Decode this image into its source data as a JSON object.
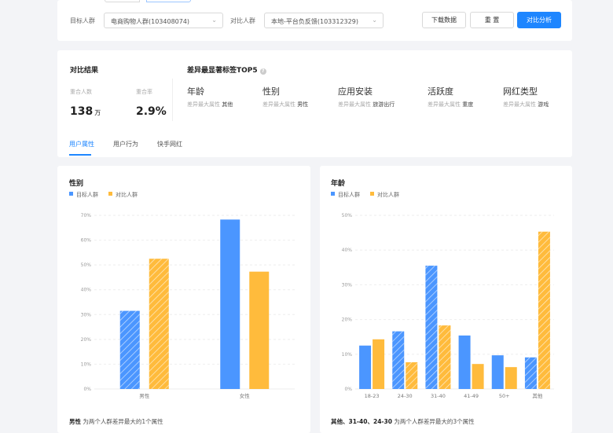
{
  "filters": {
    "target_label": "目标人群",
    "target_value": "电商购物人群(103408074)",
    "compare_label": "对比人群",
    "compare_value": "本地-平台负反馈(103312329)",
    "download": "下载数据",
    "reset": "重 置",
    "analyze": "对比分析"
  },
  "result": {
    "title": "对比结果",
    "overlap_count_label": "重合人数",
    "overlap_count": "138",
    "overlap_unit": "万",
    "overlap_rate_label": "重合率",
    "overlap_rate": "2.9%",
    "top5_title": "差异最显著标签TOP5",
    "tags": [
      {
        "name": "年龄",
        "prefix": "差异最大属性",
        "value": "其他"
      },
      {
        "name": "性别",
        "prefix": "差异最大属性",
        "value": "男性"
      },
      {
        "name": "应用安装",
        "prefix": "差异最大属性",
        "value": "旅游出行"
      },
      {
        "name": "活跃度",
        "prefix": "差异最大属性",
        "value": "重度"
      },
      {
        "name": "网红类型",
        "prefix": "差异最大属性",
        "value": "游戏"
      }
    ]
  },
  "tabs": [
    "用户属性",
    "用户行为",
    "快手网红"
  ],
  "colors": {
    "target": "#4b96ff",
    "compare": "#ffbb3c",
    "accent": "#1e86ff"
  },
  "chart_data": [
    {
      "type": "bar",
      "title": "性别",
      "legend": [
        "目标人群",
        "对比人群"
      ],
      "categories": [
        "男性",
        "女性"
      ],
      "yticks": [
        "0%",
        "10%",
        "20%",
        "30%",
        "40%",
        "50%",
        "60%",
        "70%"
      ],
      "ylim": [
        0,
        70
      ],
      "series": [
        {
          "name": "目标人群",
          "values": [
            31.5,
            68.3
          ]
        },
        {
          "name": "对比人群",
          "values": [
            52.5,
            47.3
          ]
        }
      ],
      "highlighted": [
        "男性"
      ],
      "note_bold": "男性",
      "note": " 为两个人群差异最大的1个属性"
    },
    {
      "type": "bar",
      "title": "年龄",
      "legend": [
        "目标人群",
        "对比人群"
      ],
      "categories": [
        "18-23",
        "24-30",
        "31-40",
        "41-49",
        "50+",
        "其他"
      ],
      "yticks": [
        "0%",
        "10%",
        "20%",
        "30%",
        "40%",
        "50%"
      ],
      "ylim": [
        0,
        50
      ],
      "series": [
        {
          "name": "目标人群",
          "values": [
            12.5,
            16.6,
            35.5,
            15.4,
            9.7,
            9.1
          ]
        },
        {
          "name": "对比人群",
          "values": [
            14.3,
            7.7,
            18.3,
            7.2,
            6.3,
            45.3
          ]
        }
      ],
      "highlighted": [
        "24-30",
        "31-40",
        "其他"
      ],
      "note_bold": "其他、31-40、24-30",
      "note": " 为两个人群差异最大的3个属性"
    }
  ]
}
